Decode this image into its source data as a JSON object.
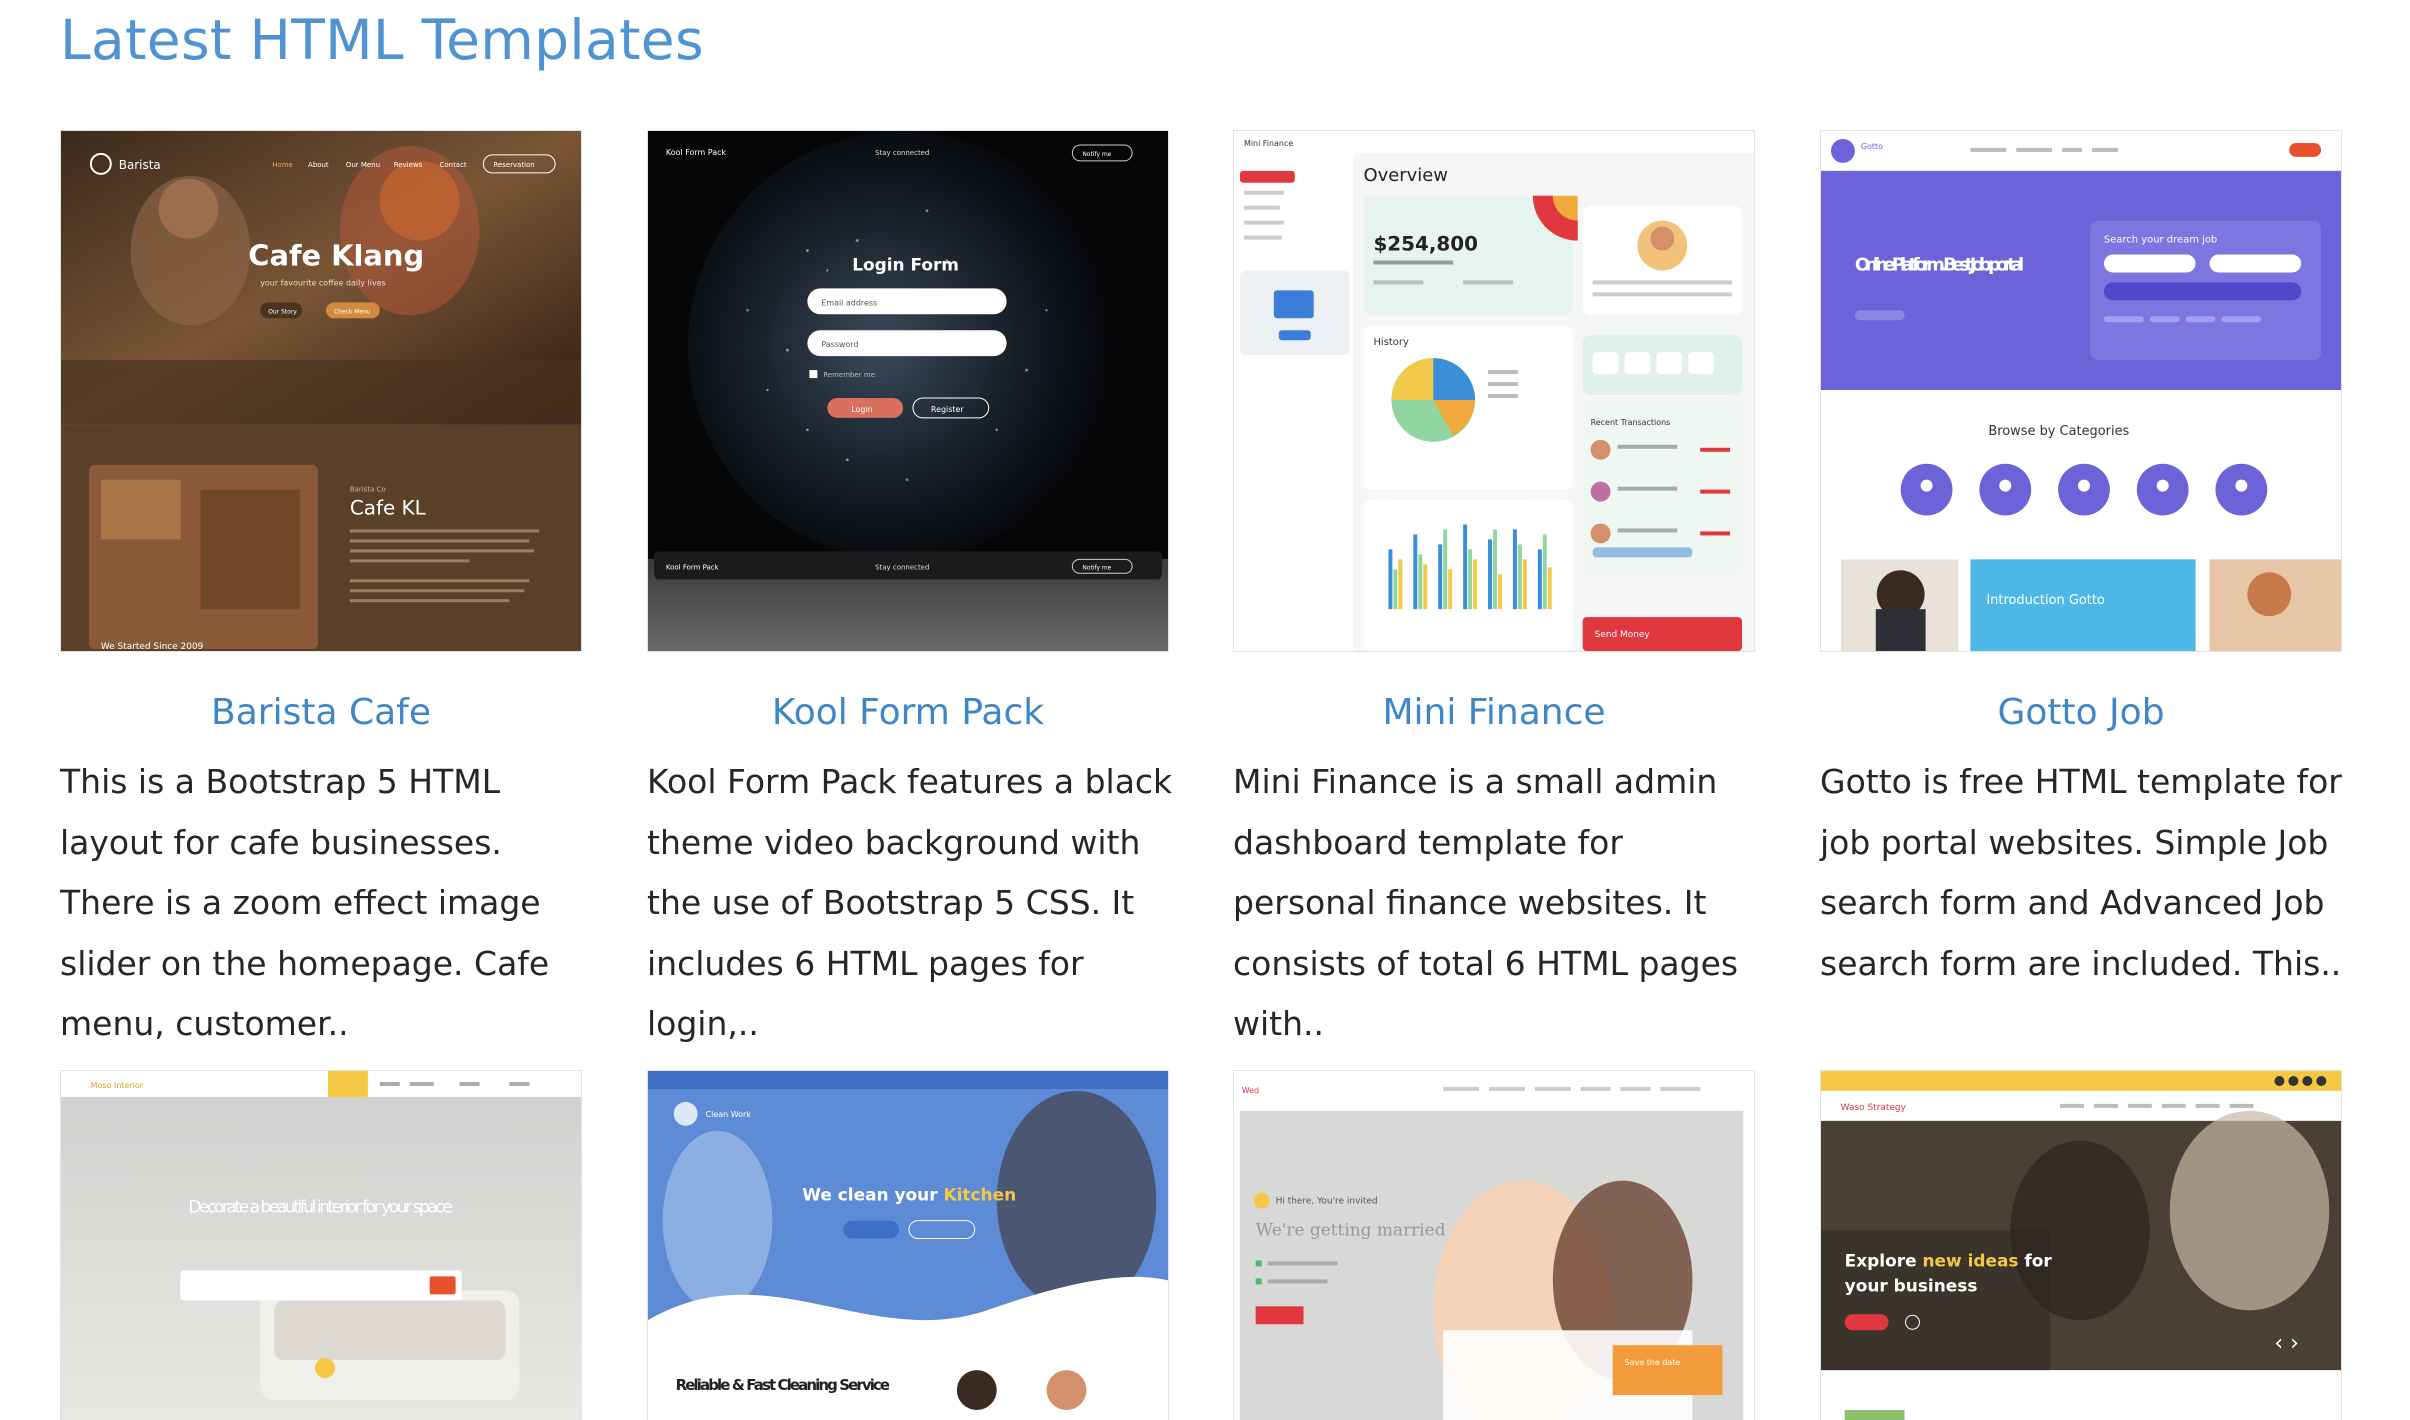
{
  "section": {
    "title": "Latest HTML Templates"
  },
  "cards": [
    {
      "title": "Barista Cafe",
      "desc": "This is a Bootstrap 5 HTML layout for cafe businesses. There is a zoom effect image slider on the homepage. Cafe menu, customer..",
      "thumb": {
        "brand": "Barista",
        "nav": [
          "Home",
          "About",
          "Our Menu",
          "Reviews",
          "Contact"
        ],
        "nav_button": "Reservation",
        "heading": "Cafe Klang",
        "subheading": "your favourite coffee daily lives",
        "buttons": [
          "Our Story",
          "Check Menu"
        ],
        "section_small": "Barista Co",
        "section_title": "Cafe KL",
        "footer_text": "We Started Since 2009"
      }
    },
    {
      "title": "Kool Form Pack",
      "desc": "Kool Form Pack features a black theme video background with the use of Bootstrap 5 CSS. It includes 6 HTML pages for login,..",
      "thumb": {
        "brand": "Kool Form Pack",
        "stay": "Stay connected",
        "notify": "Notify me",
        "form_title": "Login Form",
        "email_placeholder": "Email address",
        "password_placeholder": "Password",
        "remember": "Remember me",
        "login": "Login",
        "register": "Register"
      }
    },
    {
      "title": "Mini Finance",
      "desc": "Mini Finance is a small admin dashboard template for personal finance websites. It consists of total 6 HTML pages with..",
      "thumb": {
        "brand": "Mini Finance",
        "overview": "Overview",
        "balance": "$254,800",
        "history": "History",
        "recent": "Recent Transactions",
        "send": "Send Money"
      }
    },
    {
      "title": "Gotto Job",
      "desc": "Gotto is free HTML template for job portal websites. Simple Job search form and Advanced Job search form are included. This..",
      "thumb": {
        "brand": "Gotto",
        "hero": "Online Platform. Best Job portal",
        "search_title": "Search your dream job",
        "browse": "Browse by Categories",
        "intro": "Introduction Gotto"
      }
    },
    {
      "title": "",
      "desc": "",
      "thumb": {
        "brand": "Moso Interior",
        "hero": "Decorate a beautiful interior for your space"
      }
    },
    {
      "title": "",
      "desc": "",
      "thumb": {
        "brand": "Clean Work",
        "hero_a": "We clean your ",
        "hero_b": "Kitchen",
        "service": "Reliable & Fast Cleaning Service"
      }
    },
    {
      "title": "",
      "desc": "",
      "thumb": {
        "brand": "Wed",
        "small": "Hi there, You're invited",
        "hero": "We're getting married",
        "save": "Save the date"
      }
    },
    {
      "title": "",
      "desc": "",
      "thumb": {
        "brand": "Waso Strategy",
        "hero_a": "Explore ",
        "hero_b": "new ideas",
        "hero_c": " for",
        "hero_d": "your business"
      }
    }
  ],
  "colors": {
    "accent": "#4f93d2",
    "card_title": "#3f86c7",
    "gotto_purple": "#6c63d8",
    "finance_red": "#e0383e",
    "kool_button": "#d9705e"
  }
}
